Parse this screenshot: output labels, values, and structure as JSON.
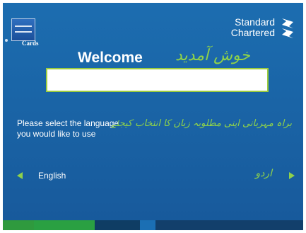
{
  "header": {
    "cards_label": "Cards",
    "brand_line1": "Standard",
    "brand_line2": "Chartered"
  },
  "welcome": {
    "en": "Welcome",
    "ur": "خوش آمدید"
  },
  "prompt": {
    "en_line1": "Please select the language",
    "en_line2": "you would like to use",
    "ur": "براہ مہربانی اپنی مطلوبہ زبان کا انتخاب کیجئے"
  },
  "options": {
    "english": "English",
    "urdu": "اردو"
  },
  "colors": {
    "background": "#1a64a6",
    "accent": "#8fd24a",
    "footer": [
      "#2f9a3e",
      "#2aa042",
      "#0f3d64",
      "#1b6fb4",
      "#123f6b"
    ]
  },
  "icons": {
    "left": "triangle-left-icon",
    "right": "triangle-right-icon",
    "brand": "standard-chartered-logo-icon",
    "card": "amex-card-icon"
  }
}
